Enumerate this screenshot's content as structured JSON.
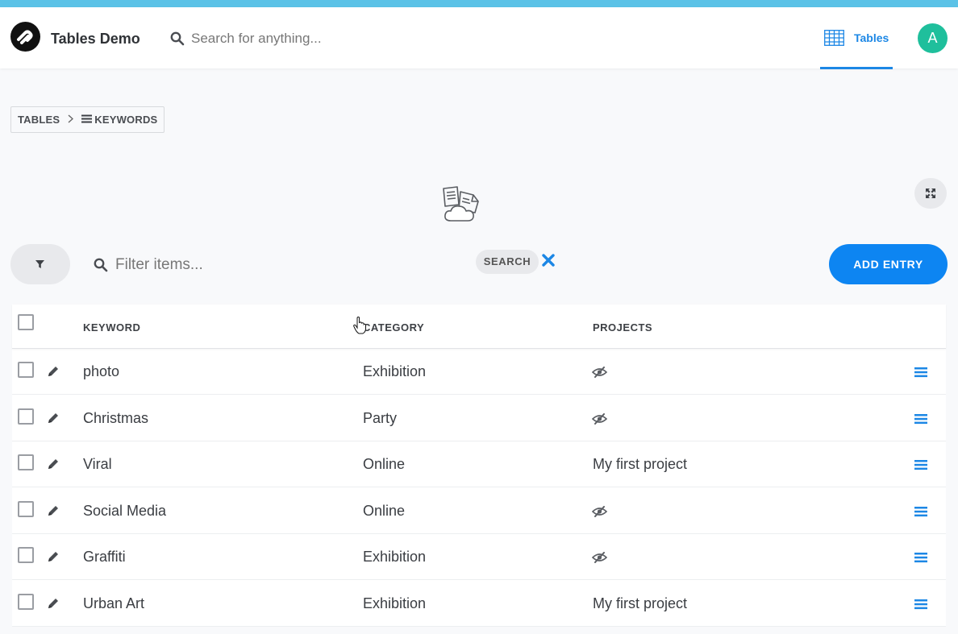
{
  "header": {
    "app_title": "Tables Demo",
    "search_placeholder": "Search for anything...",
    "nav_tables_label": "Tables",
    "avatar_initial": "A",
    "accent_color": "#1c87e5",
    "stripe_color": "#5bc2e7",
    "avatar_color": "#1fbf9c"
  },
  "breadcrumb": {
    "root": "TABLES",
    "current": "KEYWORDS",
    "separator_icon": "chevron-right-icon",
    "current_icon": "menu-lines-icon"
  },
  "toolbar": {
    "filter_placeholder": "Filter items...",
    "search_chip": "SEARCH",
    "add_entry_label": "ADD ENTRY",
    "add_entry_color": "#0d85f2"
  },
  "table": {
    "columns": [
      "KEYWORD",
      "CATEGORY",
      "PROJECTS"
    ],
    "rows": [
      {
        "keyword": "photo",
        "category": "Exhibition",
        "projects": "",
        "projects_icon": "eye-slash-icon"
      },
      {
        "keyword": "Christmas",
        "category": "Party",
        "projects": "",
        "projects_icon": "eye-slash-icon"
      },
      {
        "keyword": "Viral",
        "category": "Online",
        "projects": "My first project",
        "projects_icon": ""
      },
      {
        "keyword": "Social Media",
        "category": "Online",
        "projects": "",
        "projects_icon": "eye-slash-icon"
      },
      {
        "keyword": "Graffiti",
        "category": "Exhibition",
        "projects": "",
        "projects_icon": "eye-slash-icon"
      },
      {
        "keyword": "Urban Art",
        "category": "Exhibition",
        "projects": "My first project",
        "projects_icon": ""
      }
    ]
  }
}
